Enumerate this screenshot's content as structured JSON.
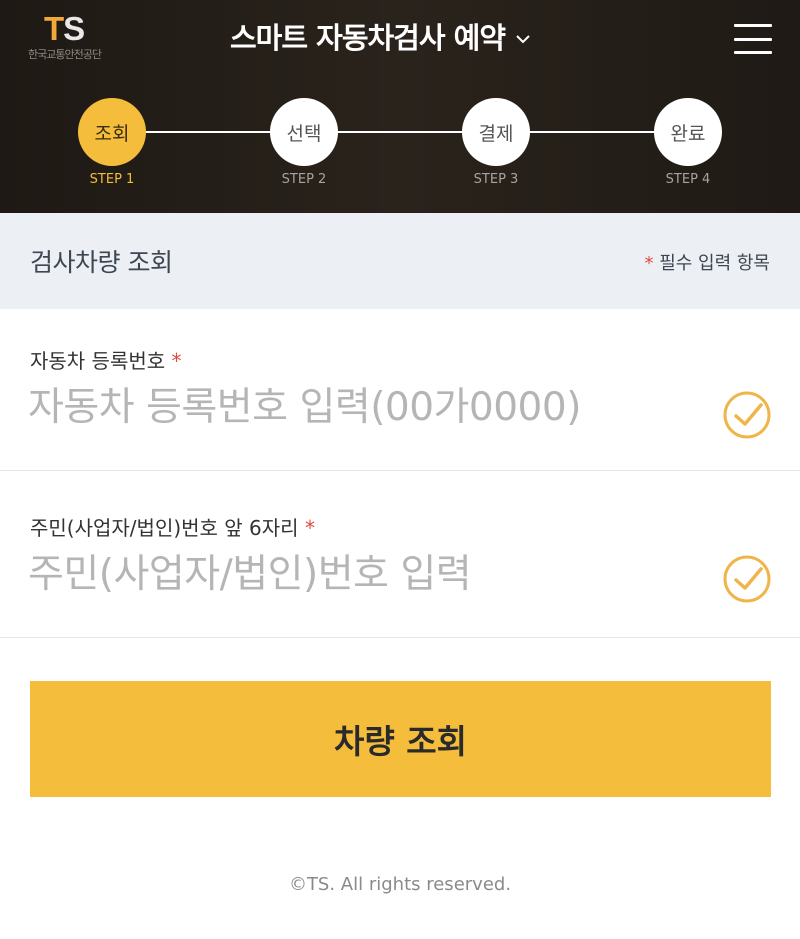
{
  "header": {
    "logo_mark_t": "T",
    "logo_mark_s": "S",
    "logo_subtitle": "한국교통안전공단",
    "title": "스마트 자동차검사 예약",
    "menu_icon": "hamburger-menu-icon",
    "dropdown_icon": "chevron-down-icon"
  },
  "steps": [
    {
      "label": "조회",
      "caption": "STEP 1",
      "active": true
    },
    {
      "label": "선택",
      "caption": "STEP 2",
      "active": false
    },
    {
      "label": "결제",
      "caption": "STEP 3",
      "active": false
    },
    {
      "label": "완료",
      "caption": "STEP 4",
      "active": false
    }
  ],
  "section": {
    "title": "검사차량 조회",
    "required_star": "*",
    "required_note": "필수 입력 항목"
  },
  "fields": {
    "plate": {
      "label": "자동차 등록번호",
      "star": "*",
      "value": "",
      "placeholder": "자동차 등록번호 입력(00가0000)"
    },
    "resident": {
      "label": "주민(사업자/법인)번호 앞 6자리",
      "star": "*",
      "value": "",
      "placeholder": "주민(사업자/법인)번호 입력"
    }
  },
  "search_button": {
    "label": "차량 조회"
  },
  "footer": {
    "text": "©TS. All rights reserved."
  },
  "colors": {
    "accent": "#f5bd3c",
    "header_bg": "#231d17",
    "required_star": "#e04a3c",
    "check_icon": "#f0b54a"
  }
}
